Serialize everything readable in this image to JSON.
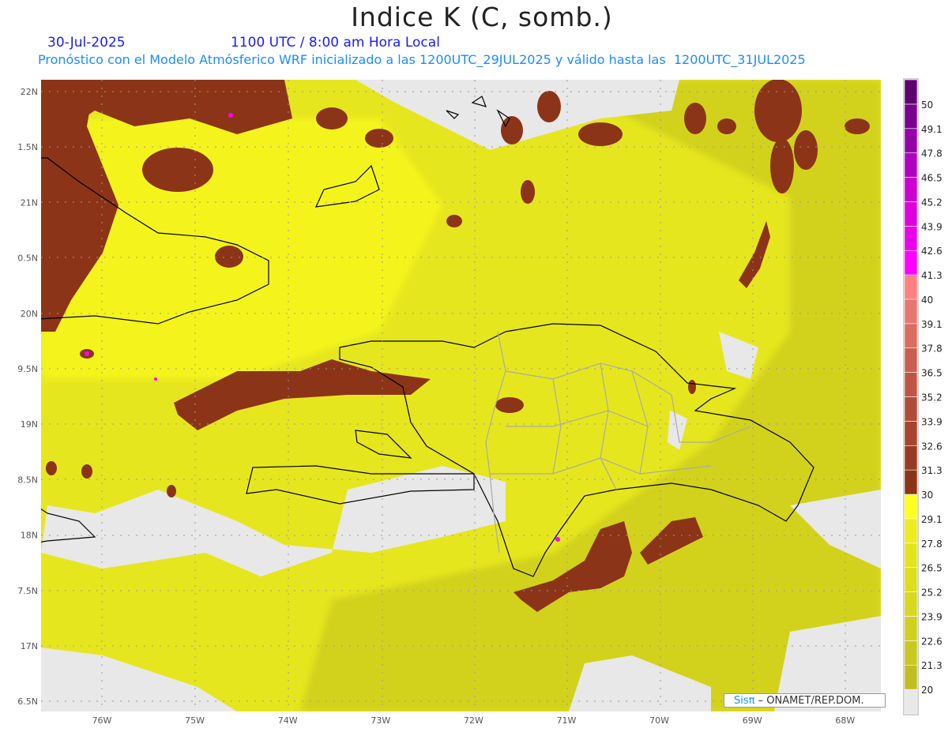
{
  "header": {
    "title": "Indice K (C, somb.)",
    "date": "30-Jul-2025",
    "time": "1100 UTC / 8:00 am Hora Local",
    "subtitle": "Pronóstico con el Modelo Atmósferico WRF inicializado a las 1200UTC_29JUL2025 y válido hasta las  1200UTC_31JUL2025"
  },
  "axes": {
    "lat_labels": [
      "22N",
      "1.5N",
      "21N",
      "0.5N",
      "20N",
      "9.5N",
      "19N",
      "8.5N",
      "18N",
      "7.5N",
      "17N",
      "6.5N"
    ],
    "lon_labels": [
      "76W",
      "75W",
      "74W",
      "73W",
      "72W",
      "71W",
      "70W",
      "69W",
      "68W"
    ]
  },
  "colorbar": {
    "labels": [
      "20",
      "21.3",
      "22.6",
      "23.9",
      "25.2",
      "26.5",
      "27.8",
      "29.1",
      "30",
      "31.3",
      "32.6",
      "33.9",
      "35.2",
      "36.5",
      "37.8",
      "39.1",
      "40",
      "41.3",
      "42.6",
      "43.9",
      "45.2",
      "46.5",
      "47.8",
      "49.1",
      "50"
    ],
    "colors": [
      "#e8e8e8",
      "#c0bf20",
      "#c8c820",
      "#d0d01f",
      "#d8d820",
      "#dede1e",
      "#e4e41e",
      "#ecec1e",
      "#ffff1f",
      "#8c3418",
      "#983a22",
      "#a6442e",
      "#b04c3a",
      "#be5646",
      "#c95e50",
      "#dc6c5e",
      "#e87670",
      "#ff8080",
      "#ff00ff",
      "#ea00ea",
      "#de00de",
      "#cc00d0",
      "#b000c0",
      "#9600aa",
      "#7c0090",
      "#600070"
    ]
  },
  "credit": {
    "brand": "Sisπ",
    "text": " – ONAMET/REP.DOM."
  }
}
